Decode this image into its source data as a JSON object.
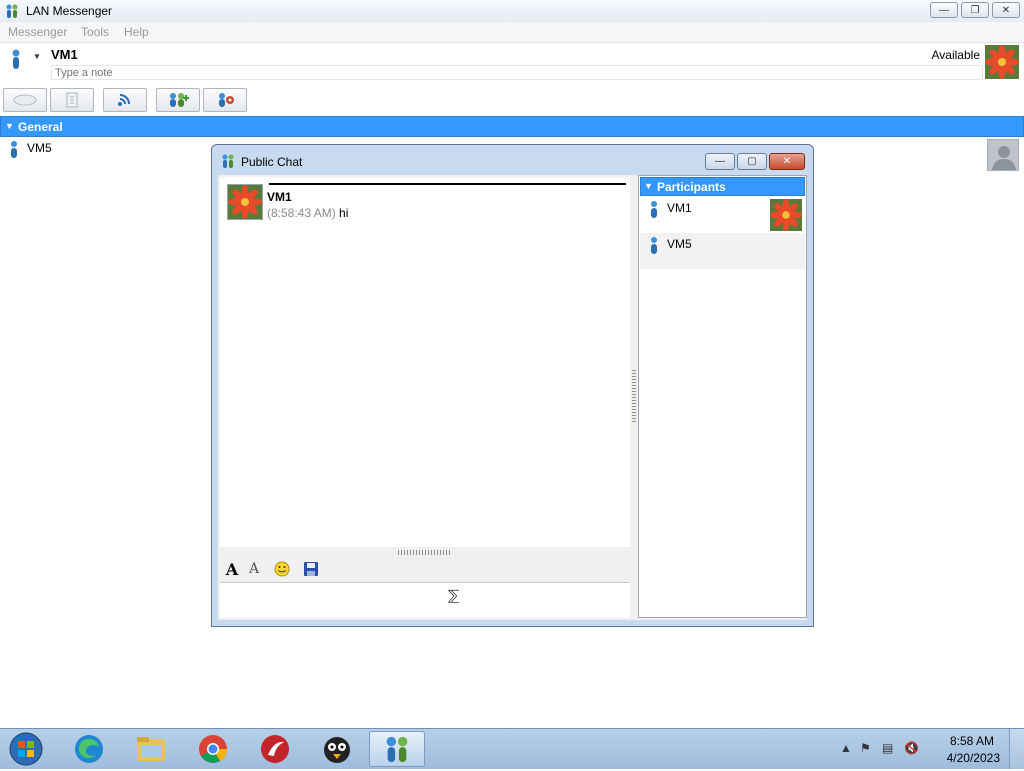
{
  "window": {
    "title": "LAN Messenger",
    "icon": "lan-messenger-icon"
  },
  "menu": {
    "items": [
      "Messenger",
      "Tools",
      "Help"
    ]
  },
  "user": {
    "name": "VM1",
    "note_placeholder": "Type a note",
    "status": "Available",
    "avatar": "flower-avatar"
  },
  "toolbar": {
    "buttons": [
      "chat-icon",
      "file-transfer-icon",
      "broadcast-icon",
      "public-chat-icon",
      "settings-icon"
    ]
  },
  "contacts": {
    "group": "General",
    "items": [
      {
        "name": "VM5",
        "avatar": "default-avatar"
      }
    ]
  },
  "chat": {
    "title": "Public Chat",
    "messages": [
      {
        "sender": "VM1",
        "time": "(8:58:43 AM)",
        "text": "hi",
        "avatar": "flower-avatar"
      }
    ],
    "input_value": "",
    "participants_header": "Participants",
    "participants": [
      {
        "name": "VM1",
        "avatar": "flower-avatar"
      },
      {
        "name": "VM5",
        "avatar": ""
      }
    ]
  },
  "taskbar": {
    "apps": [
      "start-orb",
      "edge",
      "file-explorer",
      "chrome",
      "app-red-icon",
      "game-bird-icon",
      "lan-messenger"
    ],
    "time": "8:58 AM",
    "date": "4/20/2023"
  },
  "colors": {
    "accent": "#3399ff",
    "taskbar": "#a9c4e1"
  }
}
